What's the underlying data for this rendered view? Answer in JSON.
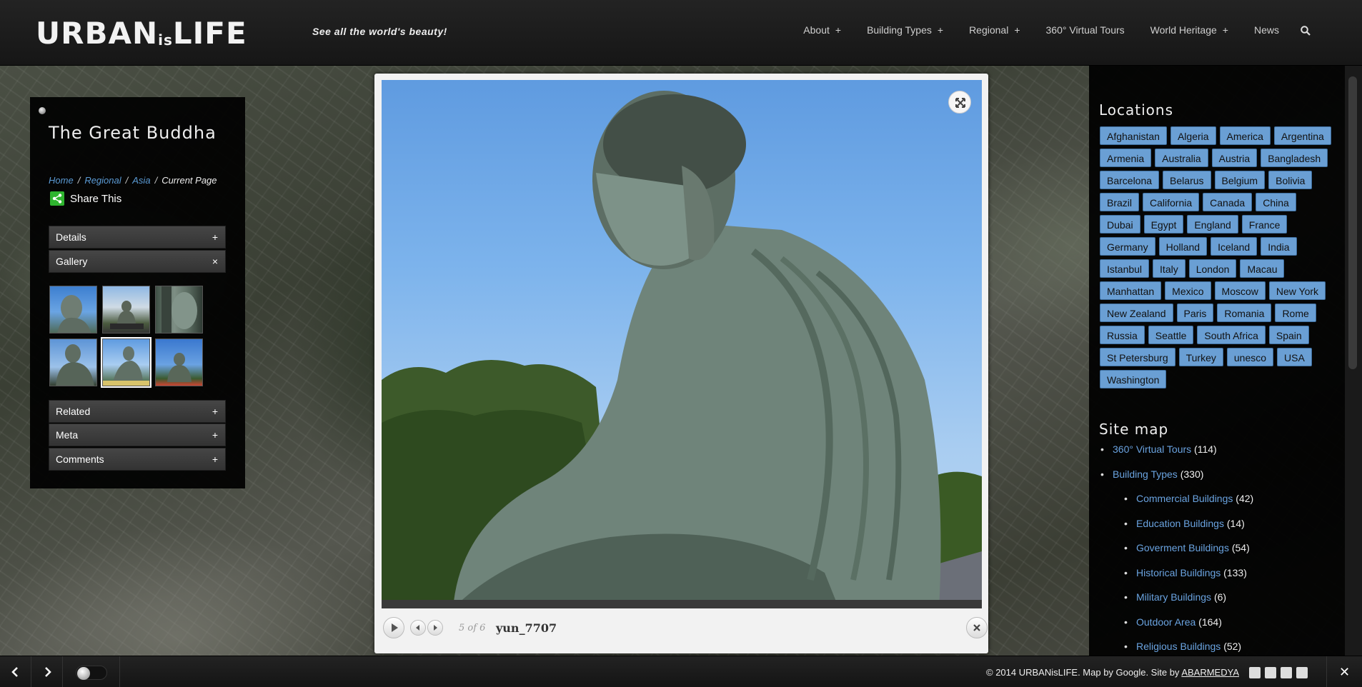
{
  "header": {
    "logo_main": "URBAN",
    "logo_small": "is",
    "logo_end": "LIFE",
    "tagline": "See all the world's beauty!",
    "nav": [
      {
        "label": "About",
        "plus": "+"
      },
      {
        "label": "Building Types",
        "plus": "+"
      },
      {
        "label": "Regional",
        "plus": "+"
      },
      {
        "label": "360° Virtual Tours",
        "plus": ""
      },
      {
        "label": "World Heritage",
        "plus": "+"
      },
      {
        "label": "News",
        "plus": ""
      }
    ]
  },
  "post": {
    "title": "The Great Buddha",
    "breadcrumb": {
      "home": "Home",
      "regional": "Regional",
      "asia": "Asia",
      "current": "Current Page",
      "sep": "/"
    },
    "share_label": "Share This",
    "accordion": {
      "details": {
        "label": "Details",
        "toggle": "+"
      },
      "gallery": {
        "label": "Gallery",
        "toggle": "×"
      },
      "related": {
        "label": "Related",
        "toggle": "+"
      },
      "meta": {
        "label": "Meta",
        "toggle": "+"
      },
      "comments": {
        "label": "Comments",
        "toggle": "+"
      }
    },
    "thumbnail_count": 6
  },
  "lightbox": {
    "counter": "5 of 6",
    "caption": "yun_7707"
  },
  "sidebar": {
    "locations_title": "Locations",
    "tags": [
      "Afghanistan",
      "Algeria",
      "America",
      "Argentina",
      "Armenia",
      "Australia",
      "Austria",
      "Bangladesh",
      "Barcelona",
      "Belarus",
      "Belgium",
      "Bolivia",
      "Brazil",
      "California",
      "Canada",
      "China",
      "Dubai",
      "Egypt",
      "England",
      "France",
      "Germany",
      "Holland",
      "Iceland",
      "India",
      "Istanbul",
      "Italy",
      "London",
      "Macau",
      "Manhattan",
      "Mexico",
      "Moscow",
      "New York",
      "New Zealand",
      "Paris",
      "Romania",
      "Rome",
      "Russia",
      "Seattle",
      "South Africa",
      "Spain",
      "St Petersburg",
      "Turkey",
      "unesco",
      "USA",
      "Washington"
    ],
    "sitemap_title": "Site map",
    "sitemap": [
      {
        "label": "360° Virtual Tours",
        "count": "(114)",
        "sub": false
      },
      {
        "label": "Building Types",
        "count": "(330)",
        "sub": false
      },
      {
        "label": "Commercial Buildings",
        "count": "(42)",
        "sub": true
      },
      {
        "label": "Education Buildings",
        "count": "(14)",
        "sub": true
      },
      {
        "label": "Goverment Buildings",
        "count": "(54)",
        "sub": true
      },
      {
        "label": "Historical Buildings",
        "count": "(133)",
        "sub": true
      },
      {
        "label": "Military Buildings",
        "count": "(6)",
        "sub": true
      },
      {
        "label": "Outdoor Area",
        "count": "(164)",
        "sub": true
      },
      {
        "label": "Religious Buildings",
        "count": "(52)",
        "sub": true
      }
    ]
  },
  "footer": {
    "copyright_prefix": "© 2014 URBANisLIFE. Map by Google. Site by ",
    "copyright_link": "ABARMEDYA",
    "close": "✕"
  },
  "colors": {
    "accent_link": "#5b9bd5",
    "tag_bg": "#6a9fd4",
    "share_green": "#2fb52f"
  }
}
